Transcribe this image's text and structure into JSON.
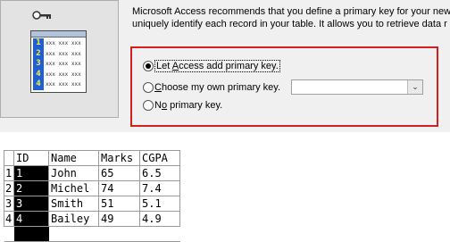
{
  "wizard": {
    "icon_numbers": [
      "1",
      "2",
      "3",
      "4",
      "4"
    ],
    "icon_cell_text": "xxx xxx xxx",
    "description_line1": "Microsoft Access recommends that you define a primary key for your new",
    "description_line2": "uniquely identify each record in your table. It allows you to retrieve data r",
    "options": [
      {
        "label_prefix": "Let ",
        "mnemonic": "A",
        "label_suffix": "ccess add primary key.",
        "selected": true
      },
      {
        "label_prefix": "",
        "mnemonic": "C",
        "label_suffix": "hoose my own primary key.",
        "selected": false
      },
      {
        "label_prefix": "N",
        "mnemonic": "o",
        "label_suffix": " primary key.",
        "selected": false
      }
    ],
    "combo_value": "",
    "combo_button_glyph": "⌄"
  },
  "table": {
    "headers": [
      "ID",
      "Name",
      "Marks",
      "CGPA"
    ],
    "rows": [
      {
        "rownum": "1",
        "id": "1",
        "name": "John",
        "marks": "65",
        "cgpa": "6.5"
      },
      {
        "rownum": "2",
        "id": "2",
        "name": "Michel",
        "marks": "74",
        "cgpa": "7.4"
      },
      {
        "rownum": "3",
        "id": "3",
        "name": "Smith",
        "marks": "51",
        "cgpa": "5.1"
      },
      {
        "rownum": "4",
        "id": "4",
        "name": "Bailey",
        "marks": "49",
        "cgpa": "4.9"
      }
    ]
  }
}
